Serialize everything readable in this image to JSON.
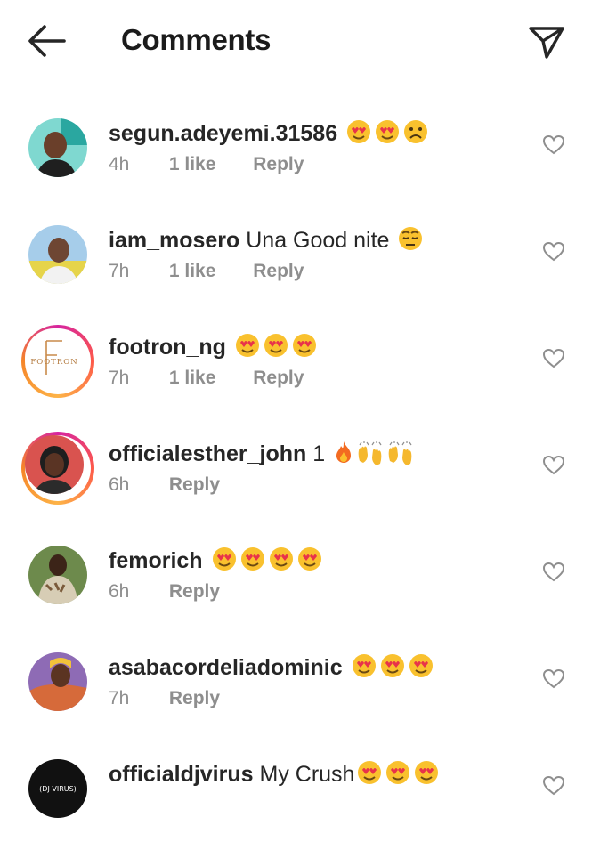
{
  "header": {
    "title": "Comments"
  },
  "comments": [
    {
      "username": "segun.adeyemi.31586",
      "text": "",
      "emojis": [
        "heart-eyes",
        "heart-eyes",
        "frown"
      ],
      "time": "4h",
      "likes": "1 like",
      "reply": "Reply"
    },
    {
      "username": "iam_mosero",
      "text": " Una Good nite",
      "emojis": [
        "weary"
      ],
      "time": "7h",
      "likes": "1 like",
      "reply": "Reply"
    },
    {
      "username": "footron_ng",
      "text": "",
      "emojis": [
        "heart-eyes",
        "heart-eyes",
        "heart-eyes"
      ],
      "time": "7h",
      "likes": "1 like",
      "reply": "Reply",
      "avatar_text": "FOOTRON"
    },
    {
      "username": "officialesther_john",
      "text": " 1",
      "emojis": [
        "fire",
        "raised-hands",
        "raised-hands"
      ],
      "time": "6h",
      "likes": "",
      "reply": "Reply"
    },
    {
      "username": "femorich",
      "text": "",
      "emojis": [
        "heart-eyes",
        "heart-eyes",
        "heart-eyes",
        "heart-eyes"
      ],
      "time": "6h",
      "likes": "",
      "reply": "Reply"
    },
    {
      "username": "asabacordeliadominic",
      "text": "",
      "emojis": [
        "heart-eyes",
        "heart-eyes",
        "heart-eyes"
      ],
      "time": "7h",
      "likes": "",
      "reply": "Reply"
    },
    {
      "username": "officialdjvirus",
      "text": " My Crush",
      "emojis": [
        "heart-eyes",
        "heart-eyes",
        "heart-eyes"
      ],
      "time": "",
      "likes": "",
      "reply": "",
      "avatar_text": "(DJ VIRUS)"
    }
  ],
  "colors": {
    "text": "#262626",
    "meta": "#8e8e8e",
    "emoji": "#f9c12e"
  }
}
